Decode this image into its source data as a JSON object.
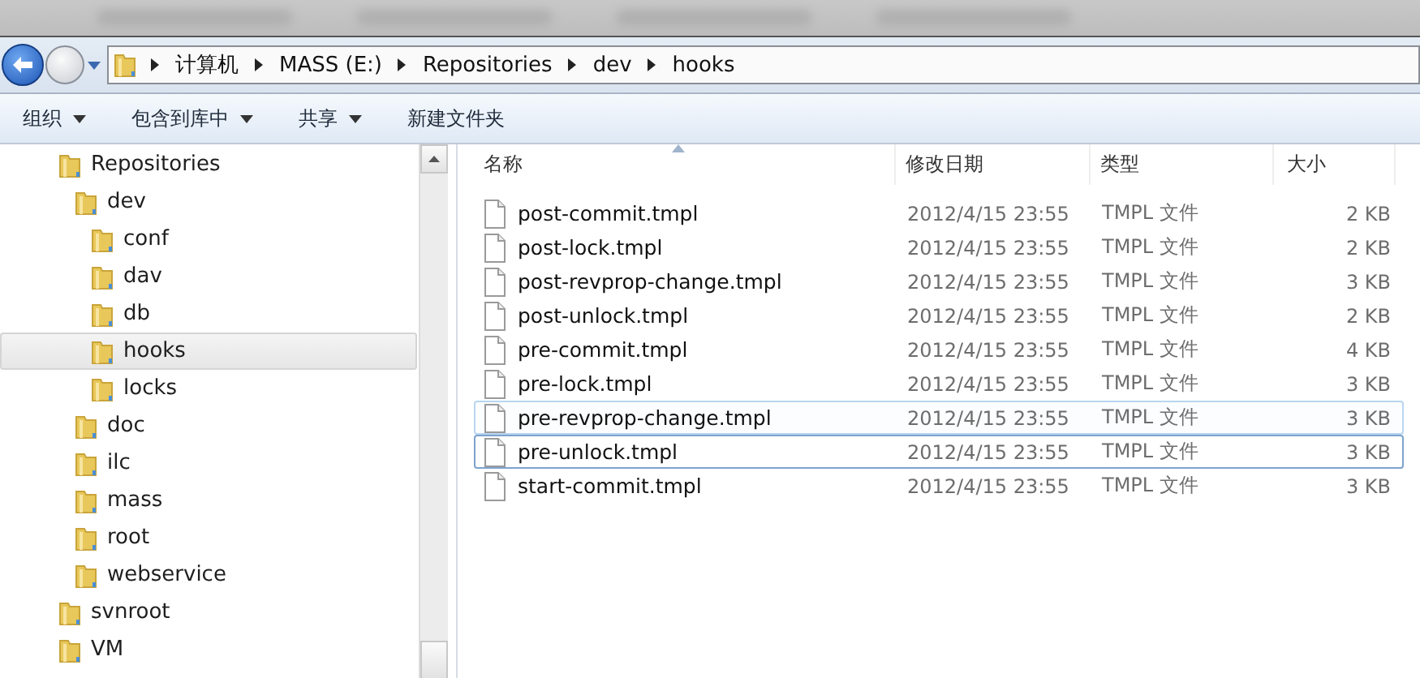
{
  "address_bar": {
    "segments": [
      "计算机",
      "MASS (E:)",
      "Repositories",
      "dev",
      "hooks"
    ]
  },
  "toolbar": {
    "items": [
      {
        "label": "组织",
        "dropdown": true
      },
      {
        "label": "包含到库中",
        "dropdown": true
      },
      {
        "label": "共享",
        "dropdown": true
      },
      {
        "label": "新建文件夹",
        "dropdown": false
      }
    ]
  },
  "sidebar": {
    "items": [
      {
        "label": "Repositories",
        "selected": false,
        "children": [
          {
            "label": "dev",
            "selected": false,
            "children": [
              {
                "label": "conf",
                "selected": false
              },
              {
                "label": "dav",
                "selected": false
              },
              {
                "label": "db",
                "selected": false
              },
              {
                "label": "hooks",
                "selected": true
              },
              {
                "label": "locks",
                "selected": false
              }
            ]
          },
          {
            "label": "doc",
            "selected": false
          },
          {
            "label": "ilc",
            "selected": false
          },
          {
            "label": "mass",
            "selected": false
          },
          {
            "label": "root",
            "selected": false
          },
          {
            "label": "webservice",
            "selected": false
          }
        ]
      },
      {
        "label": "svnroot",
        "selected": false
      },
      {
        "label": "VM",
        "selected": false
      }
    ]
  },
  "table": {
    "columns": [
      {
        "label": "名称",
        "sorted": true
      },
      {
        "label": "修改日期",
        "sorted": false
      },
      {
        "label": "类型",
        "sorted": false
      },
      {
        "label": "大小",
        "sorted": false
      }
    ],
    "rows": [
      {
        "name": "post-commit.tmpl",
        "date": "2012/4/15 23:55",
        "type": "TMPL 文件",
        "size": "2 KB",
        "hovered": false,
        "focused": false
      },
      {
        "name": "post-lock.tmpl",
        "date": "2012/4/15 23:55",
        "type": "TMPL 文件",
        "size": "2 KB",
        "hovered": false,
        "focused": false
      },
      {
        "name": "post-revprop-change.tmpl",
        "date": "2012/4/15 23:55",
        "type": "TMPL 文件",
        "size": "3 KB",
        "hovered": false,
        "focused": false
      },
      {
        "name": "post-unlock.tmpl",
        "date": "2012/4/15 23:55",
        "type": "TMPL 文件",
        "size": "2 KB",
        "hovered": false,
        "focused": false
      },
      {
        "name": "pre-commit.tmpl",
        "date": "2012/4/15 23:55",
        "type": "TMPL 文件",
        "size": "4 KB",
        "hovered": false,
        "focused": false
      },
      {
        "name": "pre-lock.tmpl",
        "date": "2012/4/15 23:55",
        "type": "TMPL 文件",
        "size": "3 KB",
        "hovered": false,
        "focused": false
      },
      {
        "name": "pre-revprop-change.tmpl",
        "date": "2012/4/15 23:55",
        "type": "TMPL 文件",
        "size": "3 KB",
        "hovered": true,
        "focused": false
      },
      {
        "name": "pre-unlock.tmpl",
        "date": "2012/4/15 23:55",
        "type": "TMPL 文件",
        "size": "3 KB",
        "hovered": false,
        "focused": true
      },
      {
        "name": "start-commit.tmpl",
        "date": "2012/4/15 23:55",
        "type": "TMPL 文件",
        "size": "3 KB",
        "hovered": false,
        "focused": false
      }
    ]
  }
}
